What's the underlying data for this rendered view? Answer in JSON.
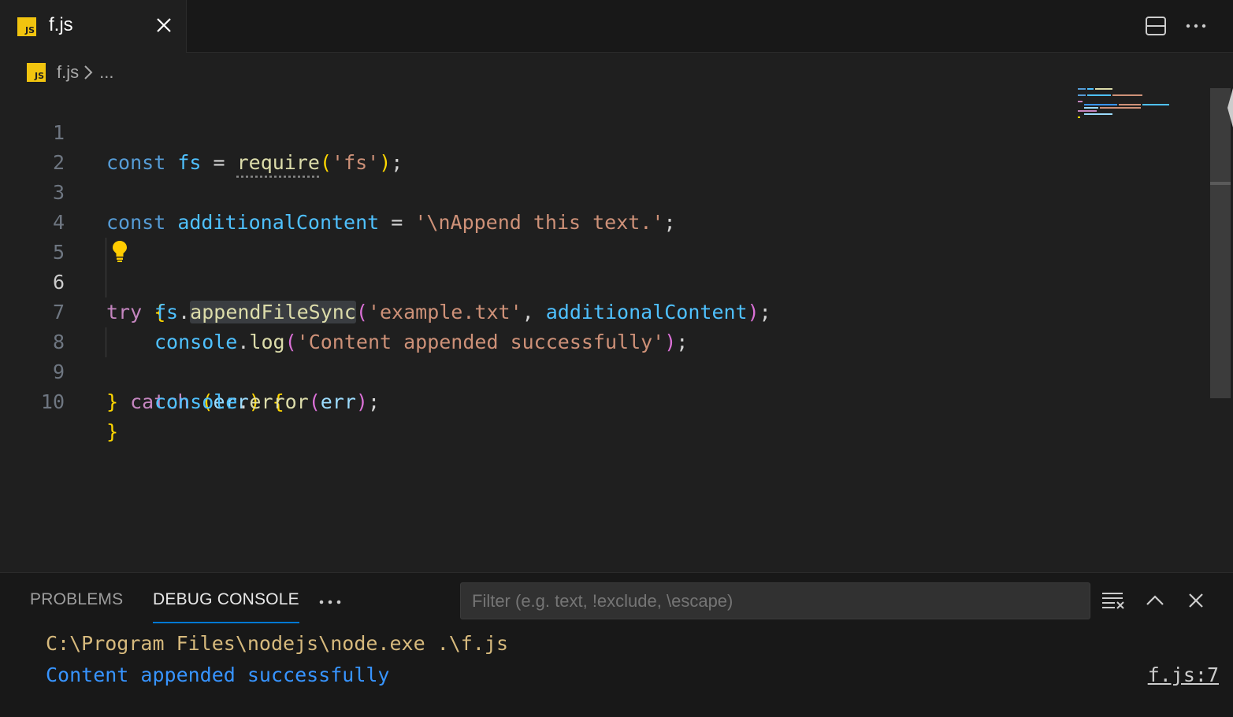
{
  "tab": {
    "label": "f.js",
    "icon": "js-file-icon",
    "badge": "JS"
  },
  "breadcrumb": {
    "file": "f.js",
    "more": "..."
  },
  "editor": {
    "active_line": 6,
    "lines": [
      {
        "n": "1"
      },
      {
        "n": "2"
      },
      {
        "n": "3"
      },
      {
        "n": "4"
      },
      {
        "n": "5"
      },
      {
        "n": "6"
      },
      {
        "n": "7"
      },
      {
        "n": "8"
      },
      {
        "n": "9"
      },
      {
        "n": "10"
      }
    ],
    "code": {
      "l1": {
        "kw": "const",
        "name": "fs",
        "eq": " = ",
        "fn": "require",
        "arg": "'fs'",
        "end": ";"
      },
      "l3": {
        "kw": "const",
        "name": "additionalContent",
        "eq": " = ",
        "str": "'\\nAppend this text.'",
        "end": ";"
      },
      "l5": {
        "kw": "try",
        "brace": "{"
      },
      "l6": {
        "obj": "fs",
        "fn": "appendFileSync",
        "arg1": "'example.txt'",
        "sep": ", ",
        "arg2": "additionalContent",
        "end": ";"
      },
      "l7": {
        "obj": "console",
        "fn": "log",
        "arg": "'Content appended successfully'",
        "end": ";"
      },
      "l8": {
        "close": "}",
        "kw": "catch",
        "param": "err",
        "brace": "{"
      },
      "l9": {
        "obj": "console",
        "fn": "error",
        "arg": "err",
        "end": ";"
      },
      "l10": {
        "close": "}"
      }
    }
  },
  "panel": {
    "tabs": [
      "PROBLEMS",
      "DEBUG CONSOLE"
    ],
    "active_tab": "DEBUG CONSOLE",
    "filter_placeholder": "Filter (e.g. text, !exclude, \\escape)",
    "output": [
      "C:\\Program Files\\nodejs\\node.exe .\\f.js",
      "Content appended successfully"
    ],
    "source_link": "f.js:7"
  },
  "colors": {
    "keyword": "#569cd6",
    "control": "#c586c0",
    "string": "#ce9178",
    "function": "#dcdcaa",
    "variable": "#4fc1ff",
    "accent": "#0078d4"
  }
}
